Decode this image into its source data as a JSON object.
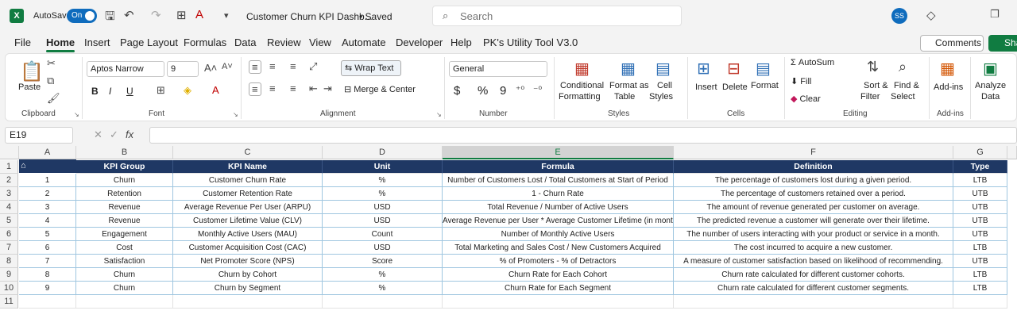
{
  "titlebar": {
    "autosave_label": "AutoSave",
    "autosave_state": "On",
    "doc_title": "Customer Churn KPI Dashb...",
    "saved_label": "• Saved",
    "search_placeholder": "Search",
    "avatar_initials": "SS"
  },
  "menu": {
    "items": [
      "File",
      "Home",
      "Insert",
      "Page Layout",
      "Formulas",
      "Data",
      "Review",
      "View",
      "Automate",
      "Developer",
      "Help",
      "PK's Utility Tool V3.0"
    ],
    "active": "Home",
    "comments_label": "Comments",
    "share_label": "Sha"
  },
  "ribbon": {
    "clipboard": {
      "paste": "Paste",
      "label": "Clipboard"
    },
    "font": {
      "name": "Aptos Narrow",
      "size": "9",
      "bold": "B",
      "italic": "I",
      "underline": "U",
      "label": "Font"
    },
    "alignment": {
      "wrap": "Wrap Text",
      "merge": "Merge & Center",
      "label": "Alignment"
    },
    "number": {
      "format": "General",
      "currency": "$",
      "percent": "%",
      "comma": "9",
      "label": "Number"
    },
    "styles": {
      "conditional": "Conditional",
      "conditional2": "Formatting",
      "format_as": "Format as",
      "table": "Table",
      "cell": "Cell",
      "styles": "Styles",
      "label": "Styles"
    },
    "cells": {
      "insert": "Insert",
      "delete": "Delete",
      "format": "Format",
      "label": "Cells"
    },
    "editing": {
      "autosum": "AutoSum",
      "fill": "Fill",
      "clear": "Clear",
      "sort": "Sort &",
      "filter": "Filter",
      "find": "Find &",
      "select": "Select",
      "label": "Editing"
    },
    "addins": {
      "addins": "Add-ins",
      "label": "Add-ins"
    },
    "analyze": {
      "line1": "Analyze",
      "line2": "Data"
    }
  },
  "formula_bar": {
    "cell_ref": "E19",
    "fx": "fx"
  },
  "columns": [
    "A",
    "B",
    "C",
    "D",
    "E",
    "F",
    "G"
  ],
  "rows": [
    "1",
    "2",
    "3",
    "4",
    "5",
    "6",
    "7",
    "8",
    "9",
    "10",
    "11"
  ],
  "table": {
    "headers": [
      "#",
      "KPI Group",
      "KPI Name",
      "Unit",
      "Formula",
      "Definition",
      "Type"
    ],
    "rows": [
      [
        "1",
        "Churn",
        "Customer Churn Rate",
        "%",
        "Number of Customers Lost / Total Customers at Start of Period",
        "The percentage of customers lost during a given period.",
        "LTB"
      ],
      [
        "2",
        "Retention",
        "Customer Retention Rate",
        "%",
        "1 - Churn Rate",
        "The percentage of customers retained over a period.",
        "UTB"
      ],
      [
        "3",
        "Revenue",
        "Average Revenue Per User (ARPU)",
        "USD",
        "Total Revenue / Number of Active Users",
        "The amount of revenue generated per customer on average.",
        "UTB"
      ],
      [
        "4",
        "Revenue",
        "Customer Lifetime Value (CLV)",
        "USD",
        "Average Revenue per User * Average Customer Lifetime (in months)",
        "The predicted revenue a customer will generate over their lifetime.",
        "UTB"
      ],
      [
        "5",
        "Engagement",
        "Monthly Active Users (MAU)",
        "Count",
        "Number of Monthly Active Users",
        "The number of users interacting with your product or service in a month.",
        "UTB"
      ],
      [
        "6",
        "Cost",
        "Customer Acquisition Cost (CAC)",
        "USD",
        "Total Marketing and Sales Cost / New Customers Acquired",
        "The cost incurred to acquire a new customer.",
        "LTB"
      ],
      [
        "7",
        "Satisfaction",
        "Net Promoter Score (NPS)",
        "Score",
        "% of Promoters - % of Detractors",
        "A measure of customer satisfaction based on likelihood of recommending.",
        "UTB"
      ],
      [
        "8",
        "Churn",
        "Churn by Cohort",
        "%",
        "Churn Rate for Each Cohort",
        "Churn rate calculated for different customer cohorts.",
        "LTB"
      ],
      [
        "9",
        "Churn",
        "Churn by Segment",
        "%",
        "Churn Rate for Each Segment",
        "Churn rate calculated for different customer segments.",
        "LTB"
      ]
    ]
  },
  "colors": {
    "header_bg": "#1f3864",
    "accent": "#107c41"
  }
}
